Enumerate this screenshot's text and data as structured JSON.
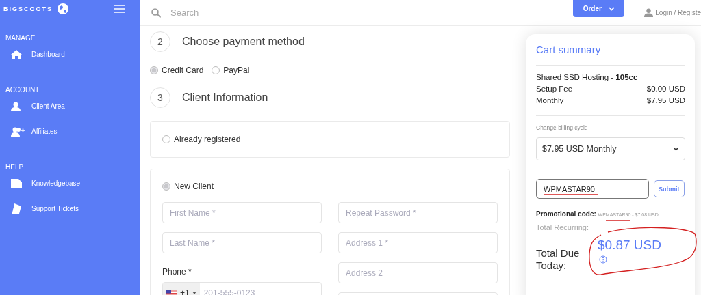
{
  "sidebar": {
    "logo": "BIGSCOOTS",
    "sections": [
      {
        "title": "MANAGE",
        "items": [
          {
            "label": "Dashboard"
          }
        ]
      },
      {
        "title": "ACCOUNT",
        "items": [
          {
            "label": "Client Area"
          },
          {
            "label": "Affiliates"
          }
        ]
      },
      {
        "title": "HELP",
        "items": [
          {
            "label": "Knowledgebase"
          },
          {
            "label": "Support Tickets"
          }
        ]
      }
    ]
  },
  "topbar": {
    "search": {
      "placeholder": "Search"
    },
    "order_button": "Order",
    "login": "Login / Registe"
  },
  "steps": [
    {
      "number": "2",
      "title": "Choose payment method"
    },
    {
      "number": "3",
      "title": "Client Information"
    }
  ],
  "payment_methods": [
    {
      "label": "Credit Card",
      "selected": true
    },
    {
      "label": "PayPal",
      "selected": false
    }
  ],
  "client_options": [
    {
      "label": "Already registered",
      "selected": false
    },
    {
      "label": "New Client",
      "selected": true
    }
  ],
  "fields_left": [
    {
      "placeholder": "First Name *"
    },
    {
      "placeholder": "Last Name *"
    }
  ],
  "phone": {
    "label": "Phone *",
    "code": "+1",
    "placeholder": "201-555-0123"
  },
  "fields_right": [
    {
      "placeholder": "Repeat Password *"
    },
    {
      "placeholder": "Address 1 *"
    },
    {
      "placeholder": "Address 2"
    }
  ],
  "cart": {
    "title": "Cart summary",
    "product": "Shared SSD Hosting - **105cc**",
    "lines": [
      {
        "label": "Setup Fee",
        "amount": "$0.00 USD"
      },
      {
        "label": "Monthly",
        "amount": "$7.95 USD"
      }
    ],
    "billing_label": "Change billing cycle",
    "billing_value": "$7.95 USD Monthly",
    "promo_value": "WPMASTAR90",
    "submit": "Submit",
    "promo_label": "Promotional code:",
    "promo_detail": "WPMASTAR90 - $7.08 USD",
    "recurring_label": "Total Recurring:",
    "due_label": "Total Due Today:",
    "due_amount": "$0.87 USD"
  },
  "annotations": [
    {
      "kind": "field_underline"
    },
    {
      "kind": "code_underline"
    },
    {
      "kind": "circle"
    }
  ]
}
